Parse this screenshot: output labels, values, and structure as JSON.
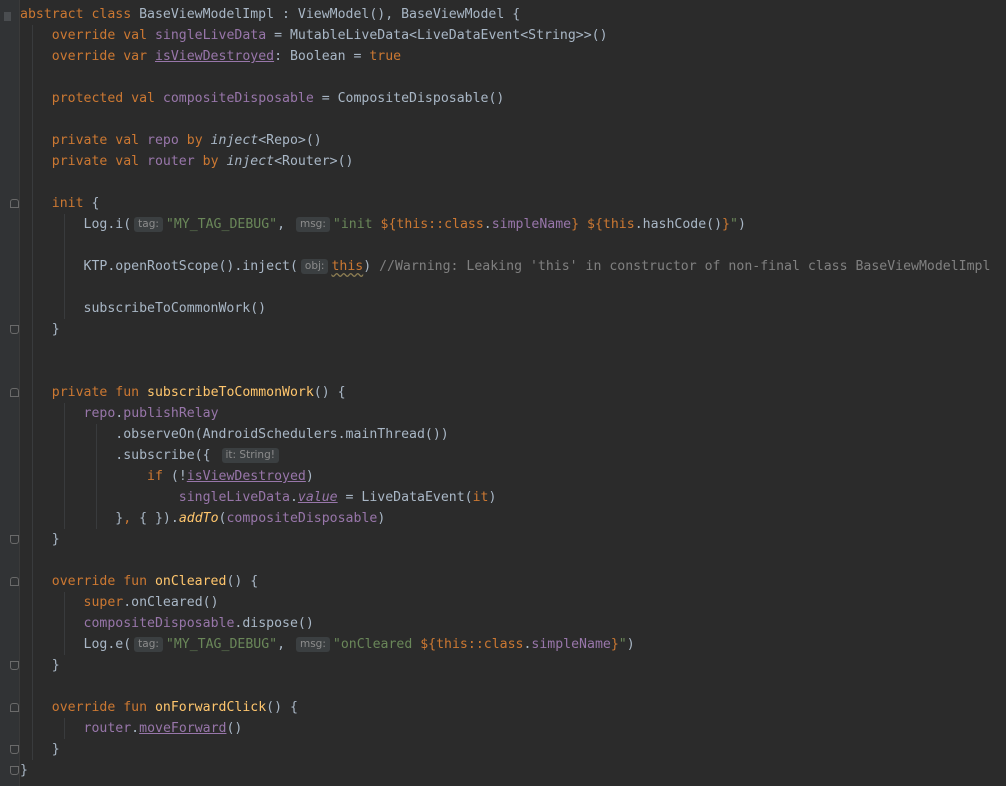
{
  "editor": {
    "language": "Kotlin",
    "lines": [
      [
        {
          "t": "abstract class ",
          "c": "kw"
        },
        {
          "t": "BaseViewModelImpl : ViewModel(), BaseViewModel {"
        }
      ],
      [
        {
          "t": "    "
        },
        {
          "t": "override val ",
          "c": "kw"
        },
        {
          "t": "singleLiveData",
          "c": "prop"
        },
        {
          "t": " = MutableLiveData<LiveDataEvent<String>>()"
        }
      ],
      [
        {
          "t": "    "
        },
        {
          "t": "override var ",
          "c": "kw"
        },
        {
          "t": "isViewDestroyed",
          "c": "prop ul"
        },
        {
          "t": ": Boolean = "
        },
        {
          "t": "true",
          "c": "kw"
        }
      ],
      [],
      [
        {
          "t": "    "
        },
        {
          "t": "protected val ",
          "c": "kw"
        },
        {
          "t": "compositeDisposable",
          "c": "prop"
        },
        {
          "t": " = CompositeDisposable()"
        }
      ],
      [],
      [
        {
          "t": "    "
        },
        {
          "t": "private val ",
          "c": "kw"
        },
        {
          "t": "repo",
          "c": "prop"
        },
        {
          "t": " by ",
          "c": "kw"
        },
        {
          "t": "inject",
          "c": "it"
        },
        {
          "t": "<Repo>()"
        }
      ],
      [
        {
          "t": "    "
        },
        {
          "t": "private val ",
          "c": "kw"
        },
        {
          "t": "router",
          "c": "prop"
        },
        {
          "t": " by ",
          "c": "kw"
        },
        {
          "t": "inject",
          "c": "it"
        },
        {
          "t": "<Router>()"
        }
      ],
      [],
      [
        {
          "t": "    "
        },
        {
          "t": "init ",
          "c": "kw"
        },
        {
          "t": "{"
        }
      ],
      [
        {
          "t": "        Log.i("
        },
        {
          "h": "tag:"
        },
        {
          "t": "\"MY_TAG_DEBUG\"",
          "c": "str"
        },
        {
          "t": ", "
        },
        {
          "h": "msg:"
        },
        {
          "t": "\"init ",
          "c": "str"
        },
        {
          "t": "${",
          "c": "kw"
        },
        {
          "t": "this",
          "c": "kw"
        },
        {
          "t": "::",
          "c": "kw"
        },
        {
          "t": "class",
          "c": "kw"
        },
        {
          "t": "."
        },
        {
          "t": "simpleName",
          "c": "prop"
        },
        {
          "t": "}",
          "c": "kw"
        },
        {
          "t": " ",
          "c": "str"
        },
        {
          "t": "${",
          "c": "kw"
        },
        {
          "t": "this",
          "c": "kw"
        },
        {
          "t": ".hashCode()"
        },
        {
          "t": "}",
          "c": "kw"
        },
        {
          "t": "\"",
          "c": "str"
        },
        {
          "t": ")"
        }
      ],
      [],
      [
        {
          "t": "        KTP.openRootScope().inject("
        },
        {
          "h": "obj:"
        },
        {
          "t": "this",
          "c": "kw warn"
        },
        {
          "t": ") "
        },
        {
          "t": "//Warning: Leaking 'this' in constructor of non-final class BaseViewModelImpl",
          "c": "cm"
        }
      ],
      [],
      [
        {
          "t": "        subscribeToCommonWork()"
        }
      ],
      [
        {
          "t": "    }"
        }
      ],
      [],
      [],
      [
        {
          "t": "    "
        },
        {
          "t": "private fun ",
          "c": "kw"
        },
        {
          "t": "subscribeToCommonWork",
          "c": "fn"
        },
        {
          "t": "() {"
        }
      ],
      [
        {
          "t": "        "
        },
        {
          "t": "repo",
          "c": "prop"
        },
        {
          "t": "."
        },
        {
          "t": "publishRelay",
          "c": "prop"
        }
      ],
      [
        {
          "t": "            .observeOn(AndroidSchedulers.mainThread())"
        }
      ],
      [
        {
          "t": "            .subscribe({ "
        },
        {
          "h": "it: String!"
        }
      ],
      [
        {
          "t": "                "
        },
        {
          "t": "if ",
          "c": "kw"
        },
        {
          "t": "(!"
        },
        {
          "t": "isViewDestroyed",
          "c": "prop ul"
        },
        {
          "t": ")"
        }
      ],
      [
        {
          "t": "                    "
        },
        {
          "t": "singleLiveData",
          "c": "prop"
        },
        {
          "t": "."
        },
        {
          "t": "value",
          "c": "prop it ul"
        },
        {
          "t": " = LiveDataEvent("
        },
        {
          "t": "it",
          "c": "kw"
        },
        {
          "t": ")"
        }
      ],
      [
        {
          "t": "            }"
        },
        {
          "t": ", ",
          "c": "kw"
        },
        {
          "t": "{ })."
        },
        {
          "t": "addTo",
          "c": "ext"
        },
        {
          "t": "("
        },
        {
          "t": "compositeDisposable",
          "c": "prop"
        },
        {
          "t": ")"
        }
      ],
      [
        {
          "t": "    }"
        }
      ],
      [],
      [
        {
          "t": "    "
        },
        {
          "t": "override fun ",
          "c": "kw"
        },
        {
          "t": "onCleared",
          "c": "fn"
        },
        {
          "t": "() {"
        }
      ],
      [
        {
          "t": "        "
        },
        {
          "t": "super",
          "c": "kw"
        },
        {
          "t": ".onCleared()"
        }
      ],
      [
        {
          "t": "        "
        },
        {
          "t": "compositeDisposable",
          "c": "prop"
        },
        {
          "t": ".dispose()"
        }
      ],
      [
        {
          "t": "        Log.e("
        },
        {
          "h": "tag:"
        },
        {
          "t": "\"MY_TAG_DEBUG\"",
          "c": "str"
        },
        {
          "t": ", "
        },
        {
          "h": "msg:"
        },
        {
          "t": "\"onCleared ",
          "c": "str"
        },
        {
          "t": "${",
          "c": "kw"
        },
        {
          "t": "this",
          "c": "kw"
        },
        {
          "t": "::",
          "c": "kw"
        },
        {
          "t": "class",
          "c": "kw"
        },
        {
          "t": "."
        },
        {
          "t": "simpleName",
          "c": "prop"
        },
        {
          "t": "}",
          "c": "kw"
        },
        {
          "t": "\"",
          "c": "str"
        },
        {
          "t": ")"
        }
      ],
      [
        {
          "t": "    }"
        }
      ],
      [],
      [
        {
          "t": "    "
        },
        {
          "t": "override fun ",
          "c": "kw"
        },
        {
          "t": "onForwardClick",
          "c": "fn"
        },
        {
          "t": "() {"
        }
      ],
      [
        {
          "t": "        "
        },
        {
          "t": "router",
          "c": "prop"
        },
        {
          "t": "."
        },
        {
          "t": "moveForward",
          "c": "prop ul"
        },
        {
          "t": "()"
        }
      ],
      [
        {
          "t": "    }"
        }
      ],
      [
        {
          "t": "}"
        }
      ]
    ]
  },
  "colors": {
    "background": "#2b2b2b",
    "keyword": "#cc7832",
    "function": "#ffc66d",
    "property": "#9876aa",
    "string": "#6a8759",
    "comment": "#808080",
    "text": "#a9b7c6"
  }
}
